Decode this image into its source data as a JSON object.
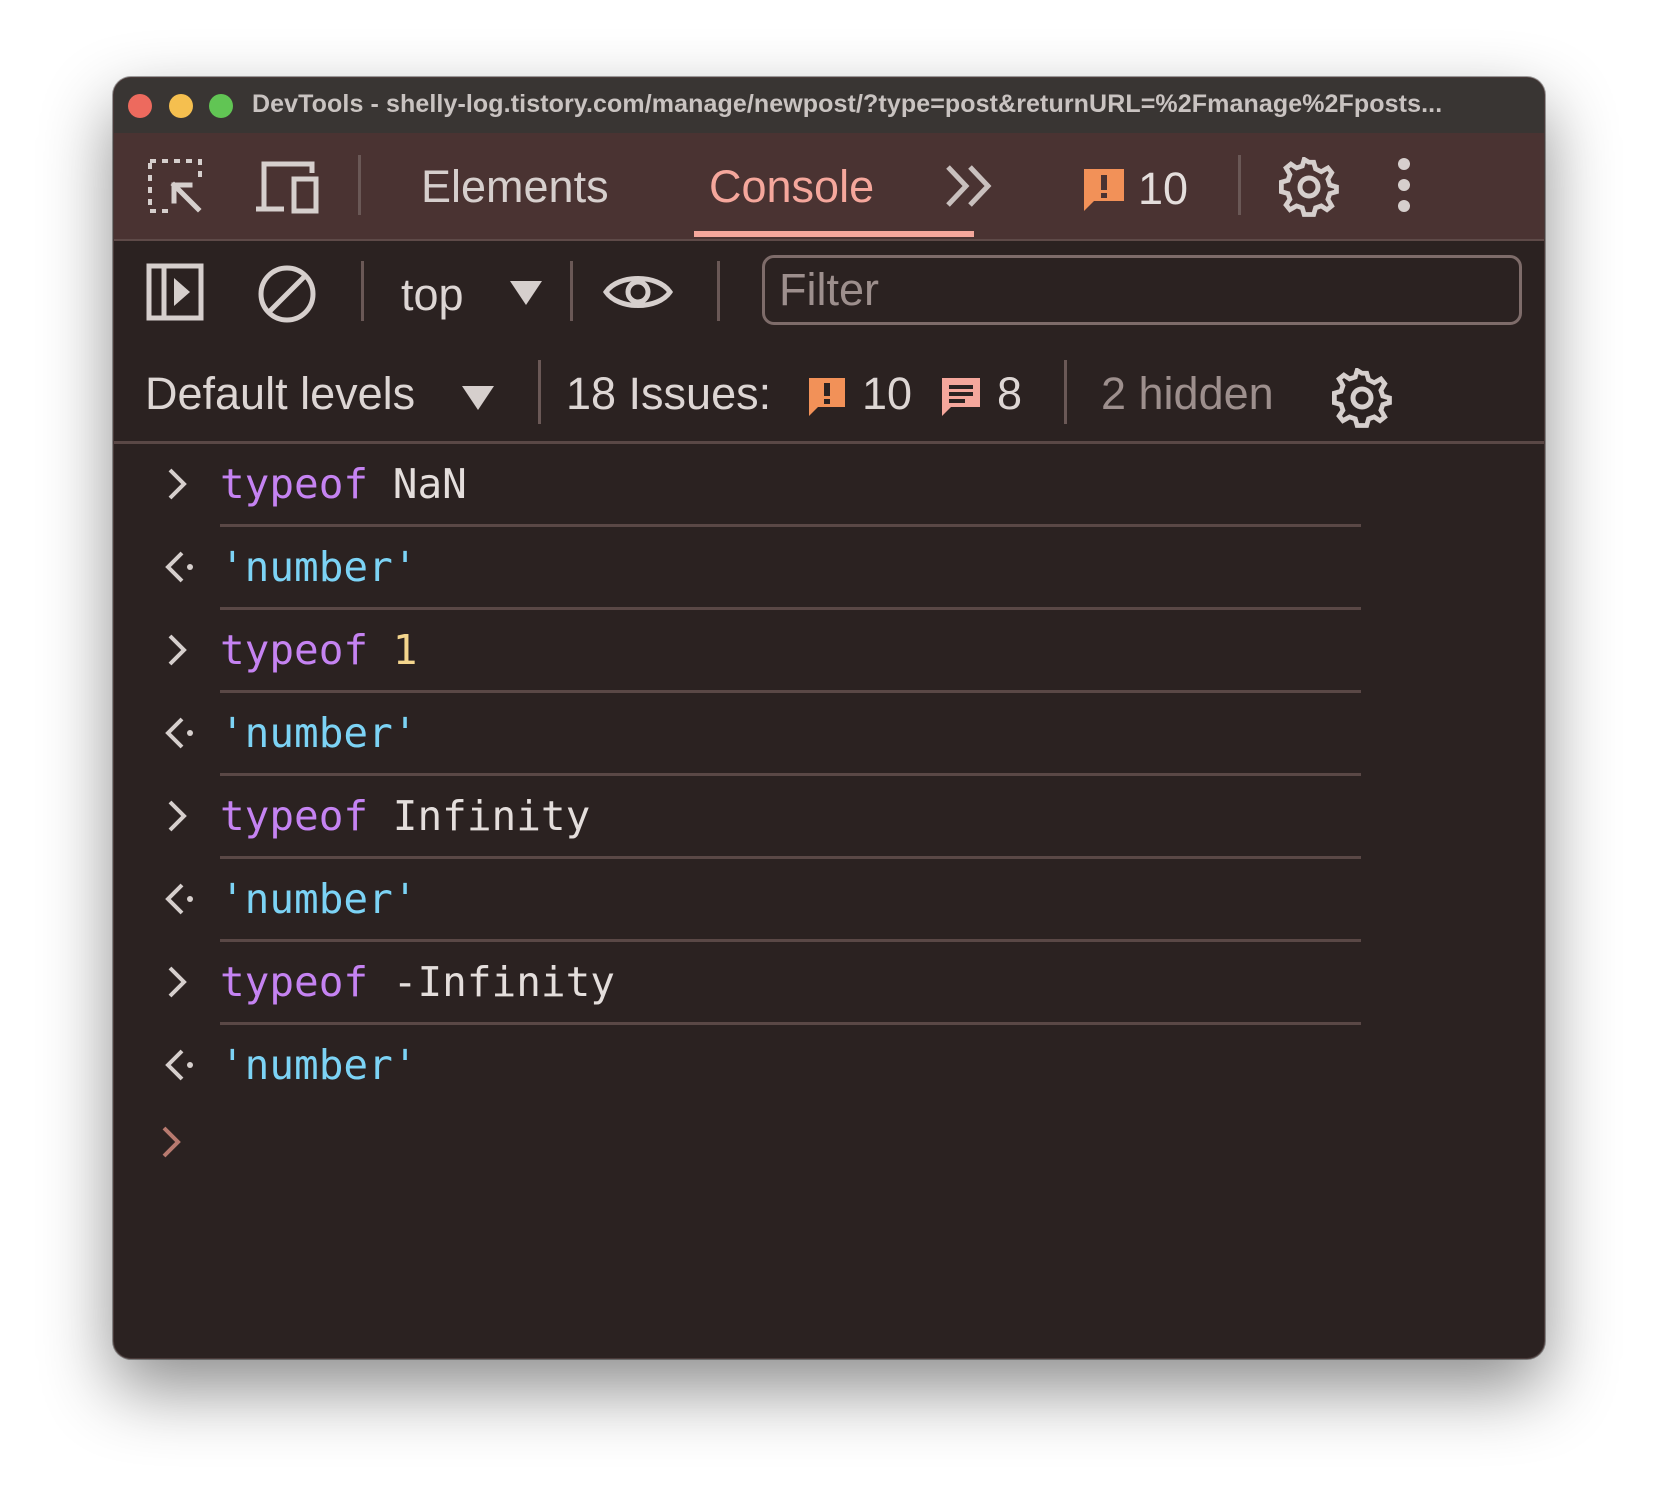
{
  "window": {
    "title": "DevTools - shelly-log.tistory.com/manage/newpost/?type=post&returnURL=%2Fmanage%2Fposts..."
  },
  "tabs": {
    "items": [
      {
        "label": "Elements",
        "active": false
      },
      {
        "label": "Console",
        "active": true
      }
    ],
    "overflow_icon": "chevron-double-right-icon",
    "issue_badge_count": "10",
    "settings_icon": "gear-icon",
    "more_icon": "kebab-menu-icon"
  },
  "console_toolbar": {
    "context": "top",
    "filter_placeholder": "Filter"
  },
  "levels_bar": {
    "levels_label": "Default levels",
    "issues_label": "18 Issues:",
    "warning_count": "10",
    "info_count": "8",
    "hidden_label": "2 hidden"
  },
  "colors": {
    "accent": "#f5a79c",
    "keyword": "#c583f2",
    "string": "#7cd3f5",
    "number": "#f4d58d",
    "warning": "#f29158"
  },
  "console": {
    "entries": [
      {
        "kind": "input",
        "keyword": "typeof",
        "operand": "NaN"
      },
      {
        "kind": "output",
        "value": "'number'"
      },
      {
        "kind": "input",
        "keyword": "typeof",
        "operand": "1"
      },
      {
        "kind": "output",
        "value": "'number'"
      },
      {
        "kind": "input",
        "keyword": "typeof",
        "operand": "Infinity"
      },
      {
        "kind": "output",
        "value": "'number'"
      },
      {
        "kind": "input",
        "keyword": "typeof",
        "operand": "-Infinity"
      },
      {
        "kind": "output",
        "value": "'number'"
      }
    ]
  }
}
